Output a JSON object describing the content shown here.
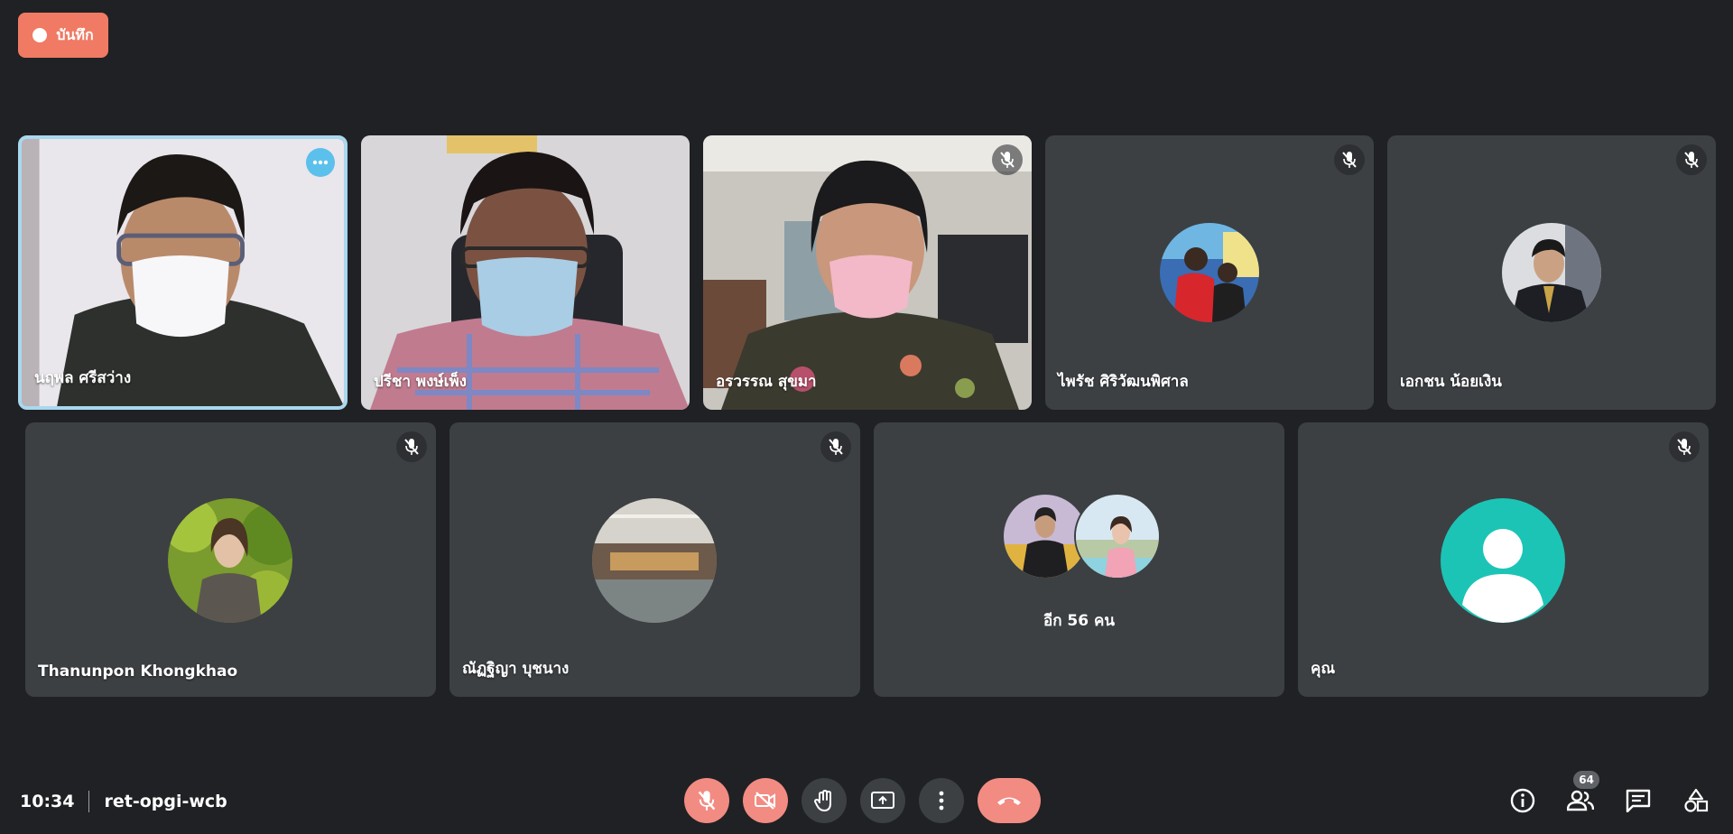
{
  "recording": {
    "label": "บันทึก"
  },
  "participants": [
    {
      "name": "นฤพล ศรีสว่าง",
      "has_video": true,
      "muted": false,
      "active": true
    },
    {
      "name": "ปรีชา พงษ์เพ็ง",
      "has_video": true,
      "muted": false
    },
    {
      "name": "อรวรรณ สุขมา",
      "has_video": true,
      "muted": true
    },
    {
      "name": "ไพรัช ศิริวัฒนพิศาล",
      "has_video": false,
      "muted": true
    },
    {
      "name": "เอกชน น้อยเงิน",
      "has_video": false,
      "muted": true
    },
    {
      "name": "Thanunpon Khongkhao",
      "has_video": false,
      "muted": true
    },
    {
      "name": "ณัฏฐิญา บุชนาง",
      "has_video": false,
      "muted": true
    },
    {
      "name": "คุณ",
      "has_video": false,
      "muted": true
    }
  ],
  "others": {
    "label": "อีก 56 คน"
  },
  "meeting": {
    "time": "10:34",
    "code": "ret-opgi-wcb"
  },
  "people_count": "64",
  "colors": {
    "background": "#202124",
    "tile": "#3c4043",
    "accent_red": "#f28b82",
    "record": "#f07a63",
    "active_border": "#a8d8ee"
  },
  "icons": [
    "mic-off-icon",
    "camera-off-icon",
    "raise-hand-icon",
    "present-screen-icon",
    "more-options-icon",
    "hang-up-icon",
    "info-icon",
    "people-icon",
    "chat-icon",
    "activities-icon"
  ]
}
